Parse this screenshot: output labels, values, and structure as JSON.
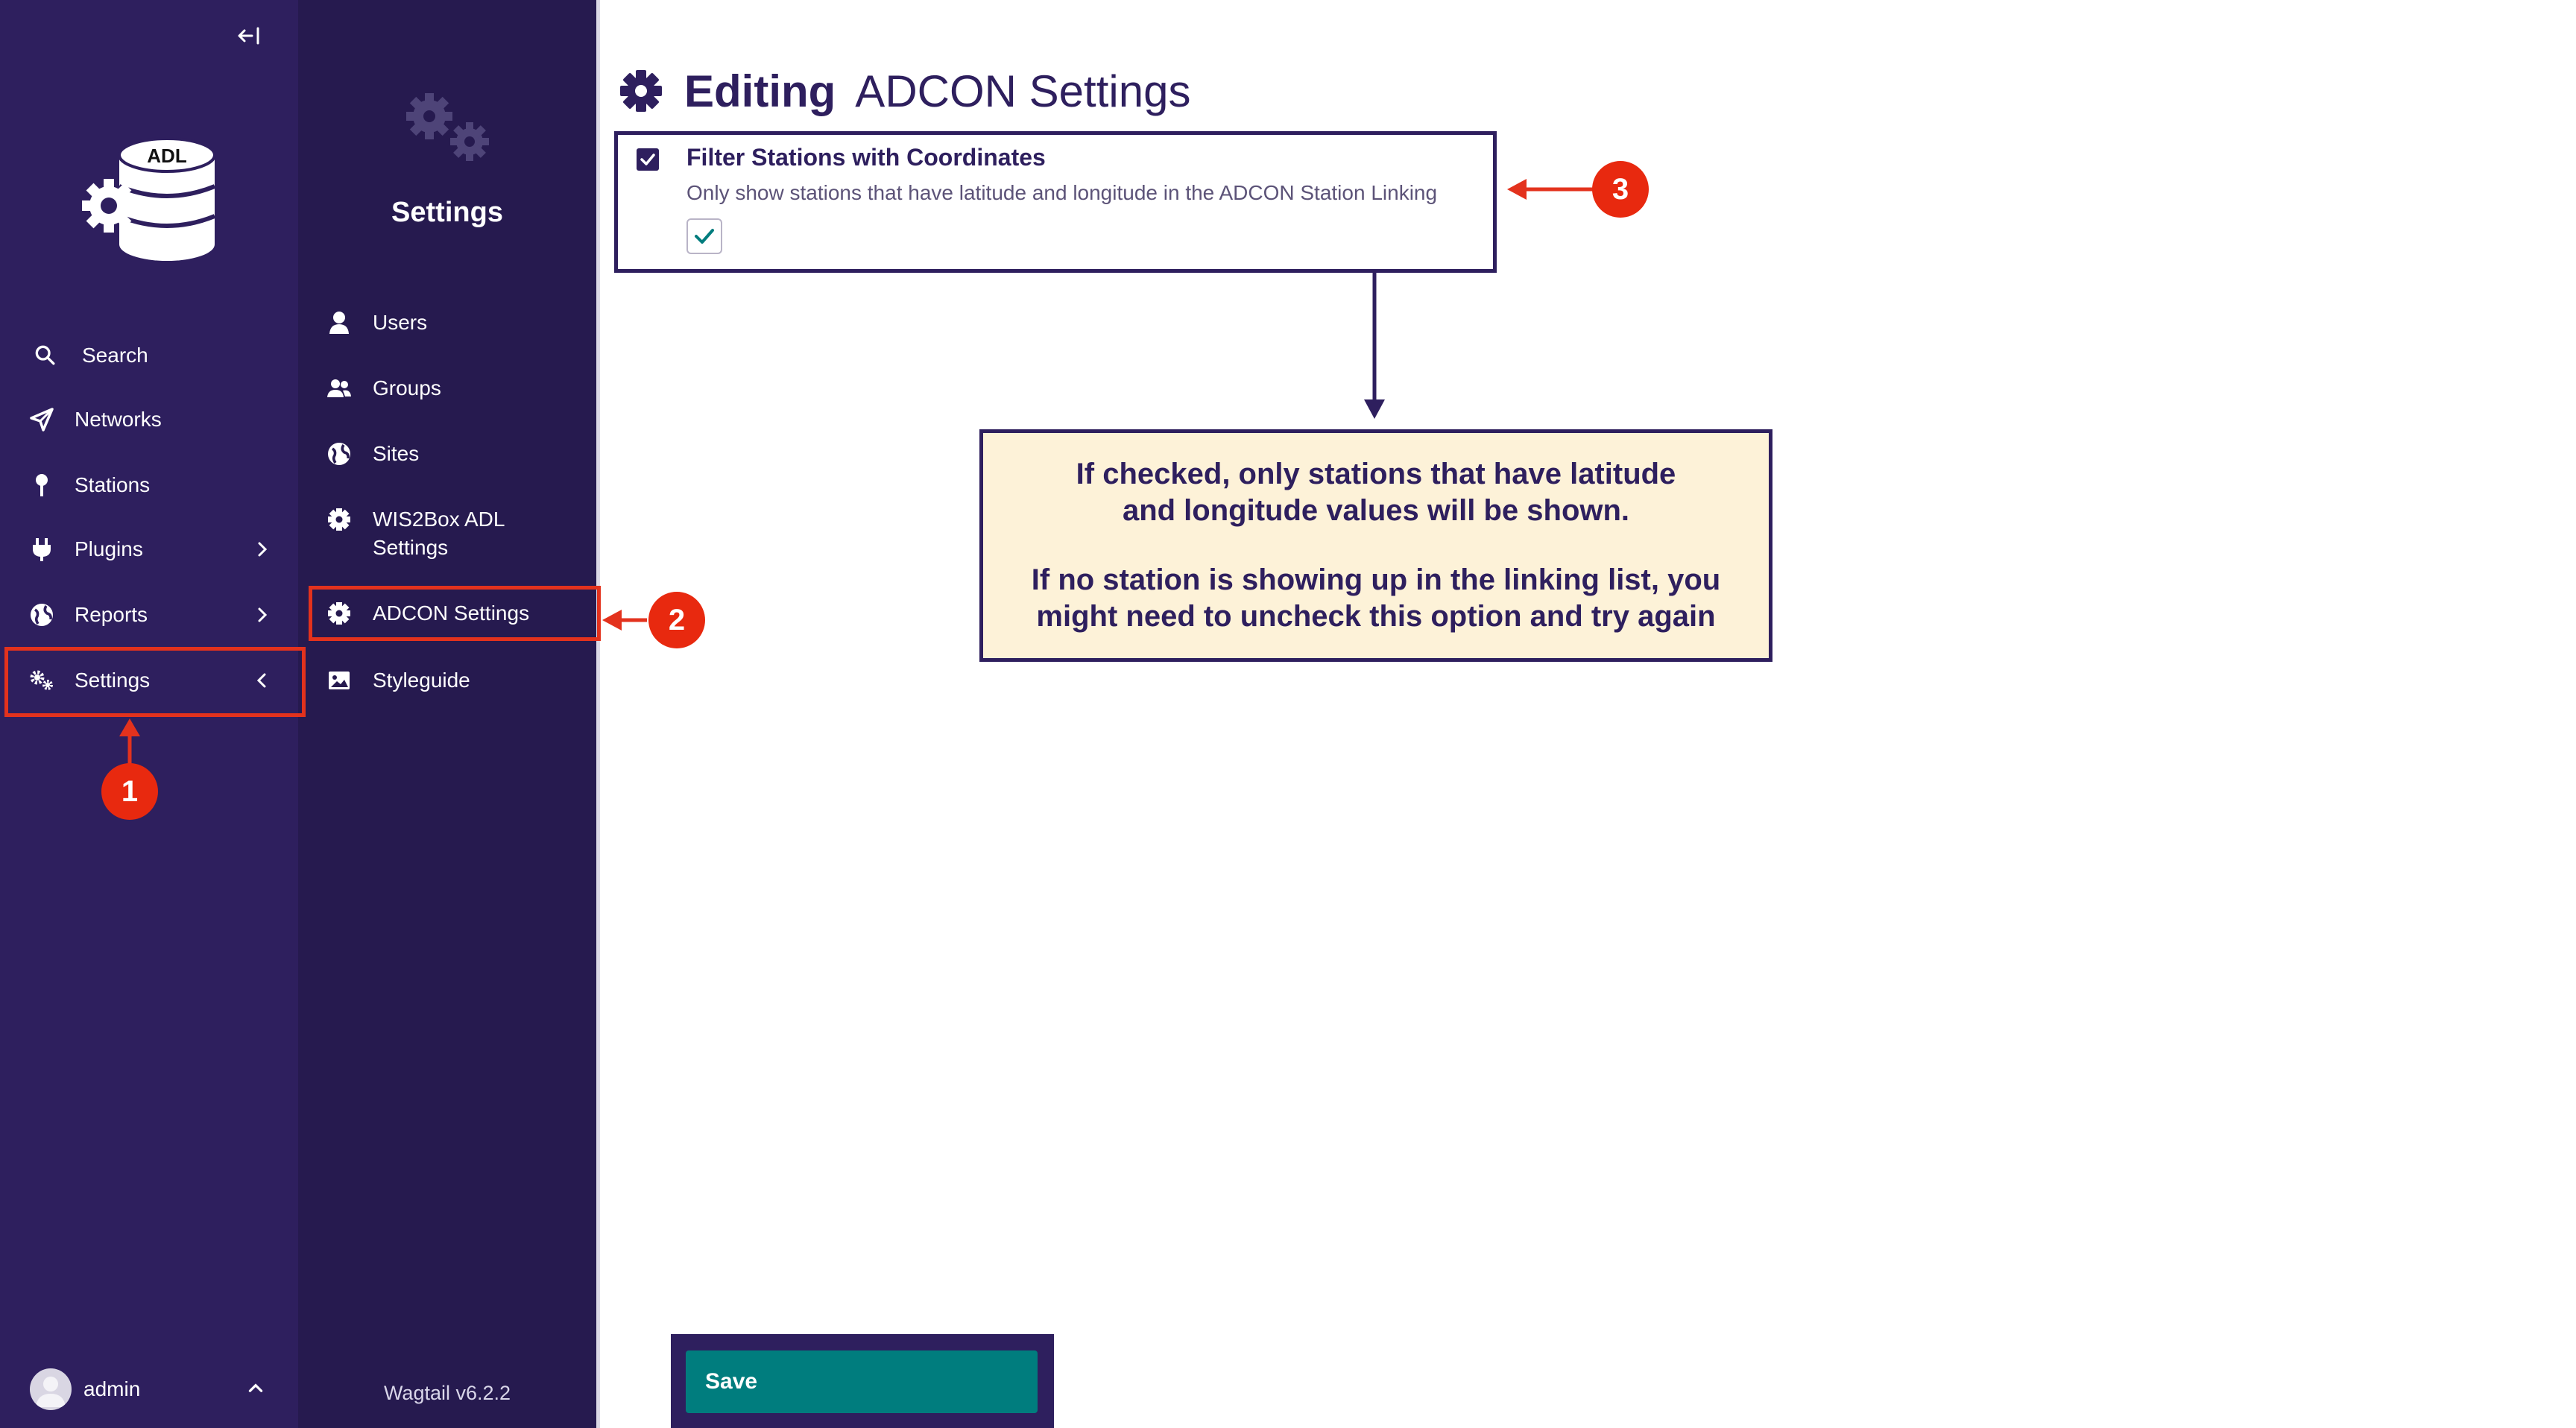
{
  "sidebar": {
    "logo_text": "ADL",
    "items": [
      {
        "label": "Search",
        "icon": "search-icon"
      },
      {
        "label": "Networks",
        "icon": "paper-plane-icon"
      },
      {
        "label": "Stations",
        "icon": "map-pin-icon"
      },
      {
        "label": "Plugins",
        "icon": "plug-icon"
      },
      {
        "label": "Reports",
        "icon": "globe-icon"
      },
      {
        "label": "Settings",
        "icon": "cogs-icon"
      }
    ],
    "user": {
      "name": "admin"
    }
  },
  "submenu": {
    "title": "Settings",
    "items": [
      {
        "label": "Users",
        "icon": "user-icon"
      },
      {
        "label": "Groups",
        "icon": "group-icon"
      },
      {
        "label": "Sites",
        "icon": "globe-icon"
      },
      {
        "label": "WIS2Box ADL Settings",
        "icon": "cog-icon"
      },
      {
        "label": "ADCON Settings",
        "icon": "cog-icon"
      },
      {
        "label": "Styleguide",
        "icon": "image-icon"
      }
    ],
    "version": "Wagtail v6.2.2"
  },
  "page": {
    "title_prefix": "Editing",
    "title_name": "ADCON Settings",
    "field": {
      "label": "Filter Stations with Coordinates",
      "help_text": "Only show stations that have latitude and longitude in the ADCON Station Linking",
      "checked": true
    },
    "save_label": "Save"
  },
  "annotation": {
    "line1": "If checked, only stations that have latitude",
    "line2": "and longitude values will be shown.",
    "line3": "If no station is showing up in the linking list, you",
    "line4": "might need to uncheck this option and try again"
  },
  "badges": [
    "1",
    "2",
    "3"
  ],
  "colors": {
    "sidebar": "#2e1f5e",
    "submenu": "#261a4f",
    "save_button": "#007d7e",
    "highlight": "#e3321d",
    "annotation_bg": "#fdf2d8"
  }
}
